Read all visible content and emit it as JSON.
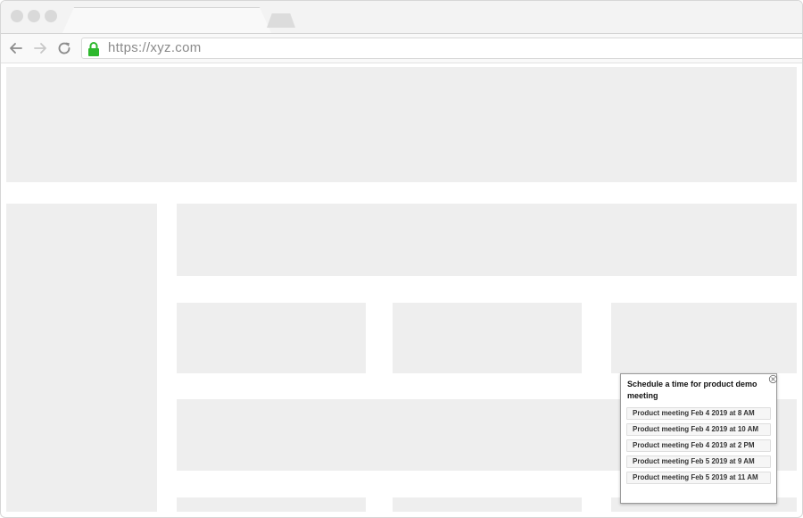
{
  "browser": {
    "url": "https://xyz.com",
    "lock_color": "#2db82d"
  },
  "popup": {
    "title": "Schedule a time for product demo meeting",
    "slots": [
      "Product meeting Feb 4 2019 at 8 AM",
      "Product meeting Feb 4 2019 at 10 AM",
      "Product meeting Feb 4 2019 at 2 PM",
      "Product meeting Feb 5 2019 at 9 AM",
      "Product meeting Feb 5 2019 at 11 AM"
    ]
  }
}
